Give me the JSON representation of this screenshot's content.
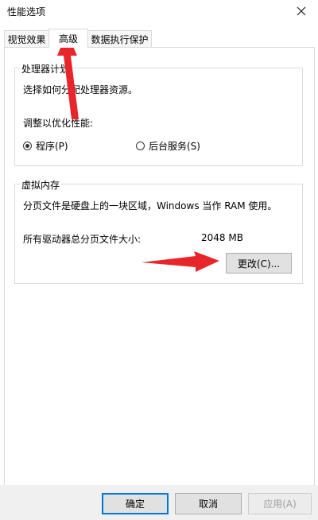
{
  "window": {
    "title": "性能选项"
  },
  "tabs": [
    {
      "label": "视觉效果"
    },
    {
      "label": "高级"
    },
    {
      "label": "数据执行保护"
    }
  ],
  "processor": {
    "legend": "处理器计划",
    "description": "选择如何分配处理器资源。",
    "optimize_label": "调整以优化性能:",
    "options": [
      {
        "label": "程序(P)",
        "selected": true
      },
      {
        "label": "后台服务(S)",
        "selected": false
      }
    ]
  },
  "virtual_memory": {
    "legend": "虚拟内存",
    "description": "分页文件是硬盘上的一块区域，Windows 当作 RAM 使用。",
    "total_label": "所有驱动器总分页文件大小:",
    "total_value": "2048 MB",
    "change_button": "更改(C)..."
  },
  "footer": {
    "ok": "确定",
    "cancel": "取消",
    "apply": "应用(A)"
  },
  "colors": {
    "annotation_arrow": "#e8262a",
    "default_button_border": "#0078d7"
  },
  "icons": {
    "close": "close-icon",
    "radio": "radio-icon"
  }
}
